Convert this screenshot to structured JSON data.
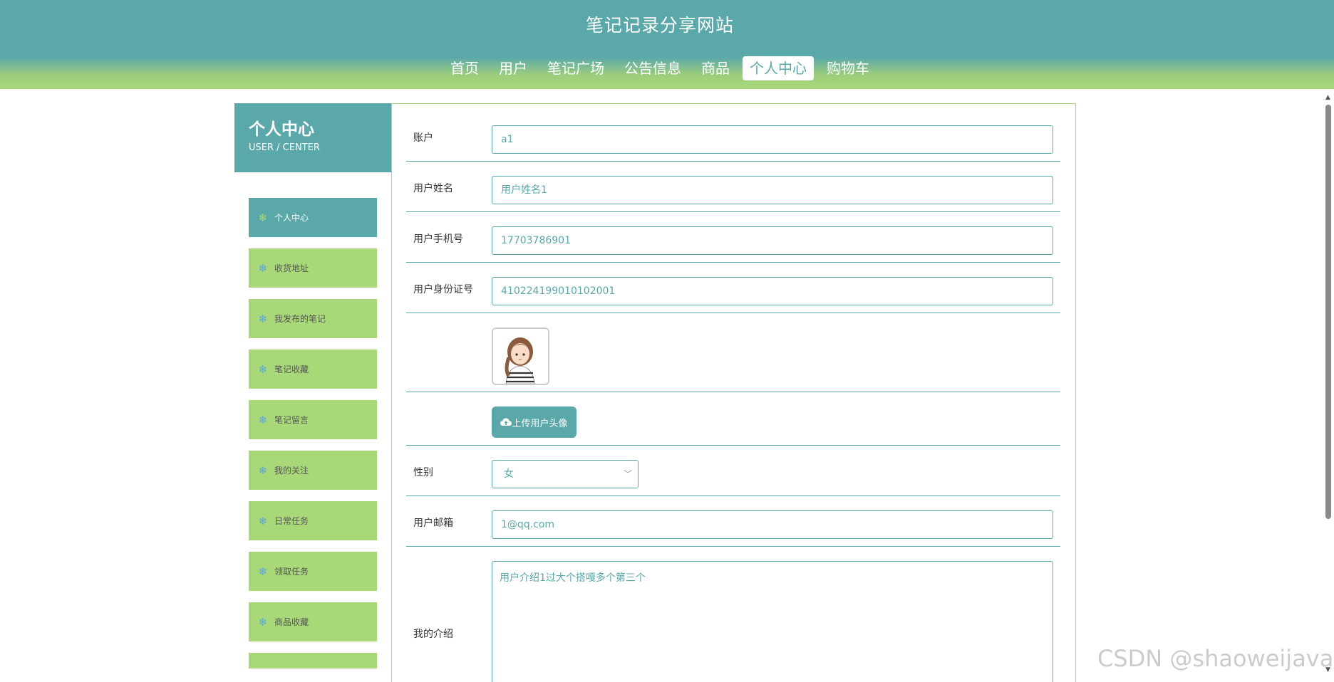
{
  "header": {
    "site_title": "笔记记录分享网站",
    "nav": [
      "首页",
      "用户",
      "笔记广场",
      "公告信息",
      "商品",
      "个人中心",
      "购物车"
    ],
    "active_nav": "个人中心"
  },
  "sidebar": {
    "title": "个人中心",
    "subtitle": "USER / CENTER",
    "items": [
      "个人中心",
      "收货地址",
      "我发布的笔记",
      "笔记收藏",
      "笔记留言",
      "我的关注",
      "日常任务",
      "领取任务",
      "商品收藏",
      ""
    ],
    "active_item": "个人中心"
  },
  "form": {
    "account_label": "账户",
    "account_value": "a1",
    "name_label": "用户姓名",
    "name_value": "用户姓名1",
    "phone_label": "用户手机号",
    "phone_value": "17703786901",
    "idcard_label": "用户身份证号",
    "idcard_value": "410224199010102001",
    "upload_label": "上传用户头像",
    "gender_label": "性别",
    "gender_value": "女",
    "email_label": "用户邮箱",
    "email_value": "1@qq.com",
    "intro_label": "我的介绍",
    "intro_value": "用户介绍1过大个搭嘎多个第三个"
  },
  "watermark": "CSDN @shaoweijava",
  "colors": {
    "primary": "#5aa8aa",
    "accent": "#a8d878"
  },
  "icons": {
    "sidebar_item": "snowflake-icon",
    "upload": "cloud-upload-icon",
    "select": "chevron-down-icon"
  }
}
